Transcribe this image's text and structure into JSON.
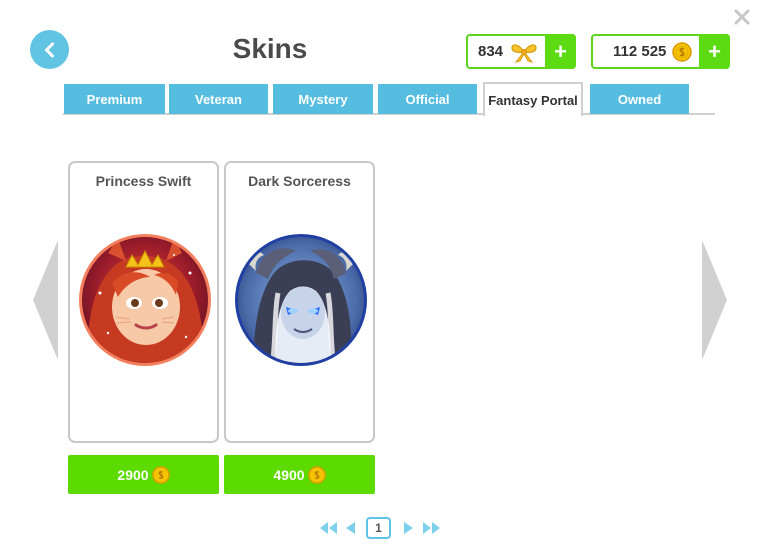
{
  "header": {
    "title": "Skins"
  },
  "currencies": {
    "bows": {
      "amount": "834",
      "add_label": "+"
    },
    "coins": {
      "amount": "112 525",
      "add_label": "+"
    }
  },
  "tabs": [
    {
      "label": "Premium"
    },
    {
      "label": "Veteran"
    },
    {
      "label": "Mystery"
    },
    {
      "label": "Official"
    },
    {
      "label": "Fantasy Portal",
      "active": true
    },
    {
      "label": "Owned"
    }
  ],
  "skins": [
    {
      "name": "Princess Swift",
      "price": "2900",
      "icon": "princess-swift-portrait"
    },
    {
      "name": "Dark Sorceress",
      "price": "4900",
      "icon": "dark-sorceress-portrait"
    }
  ],
  "pagination": {
    "current_page": "1"
  },
  "colors": {
    "accent_blue": "#55bde0",
    "buy_green": "#5cdb00",
    "coin_gold": "#f5c400"
  }
}
